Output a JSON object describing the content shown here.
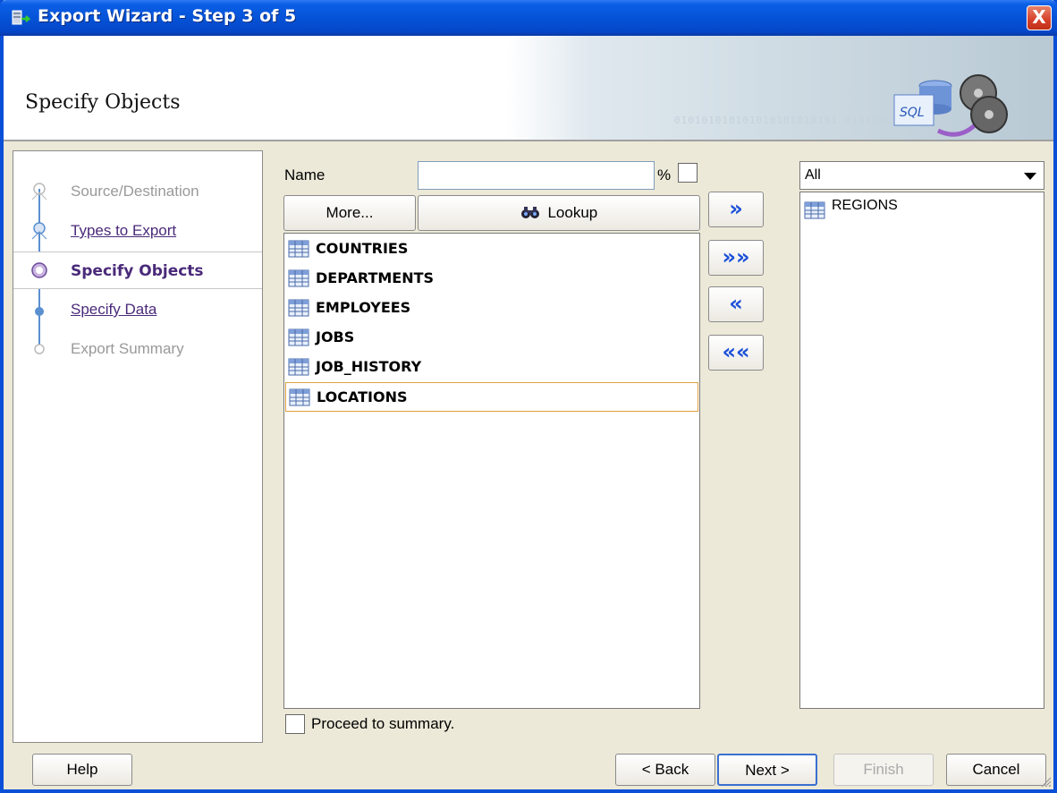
{
  "window": {
    "title": "Export Wizard - Step 3 of 5",
    "close_label": "X"
  },
  "header": {
    "title": "Specify Objects",
    "binary_text": "010101010101010101010101 01010101010",
    "art_label": "SQL"
  },
  "nav": {
    "items": [
      {
        "label": "Source/Destination",
        "state": "disabled"
      },
      {
        "label": "Types to Export",
        "state": "link"
      },
      {
        "label": "Specify Objects",
        "state": "current"
      },
      {
        "label": "Specify Data",
        "state": "link"
      },
      {
        "label": "Export Summary",
        "state": "disabled"
      }
    ]
  },
  "filter": {
    "name_label": "Name",
    "name_value": "",
    "percent_label": "%",
    "more_button": "More...",
    "lookup_button": "Lookup"
  },
  "available_objects": [
    "COUNTRIES",
    "DEPARTMENTS",
    "EMPLOYEES",
    "JOBS",
    "JOB_HISTORY",
    "LOCATIONS"
  ],
  "selected_available": "LOCATIONS",
  "move_buttons": {
    "add": "»",
    "add_all": "»»",
    "remove": "«",
    "remove_all": "««"
  },
  "type_filter": {
    "selected": "All"
  },
  "selected_objects": [
    "REGIONS"
  ],
  "proceed": {
    "label": "Proceed to summary.",
    "checked": false
  },
  "footer": {
    "help": "Help",
    "back": "< Back",
    "next": "Next >",
    "finish": "Finish",
    "cancel": "Cancel"
  },
  "colors": {
    "titlebar": "#0553d8",
    "nav_link": "#4a2a7a",
    "arrow_blue": "#1a4fd8",
    "selection_border": "#e0a040"
  }
}
